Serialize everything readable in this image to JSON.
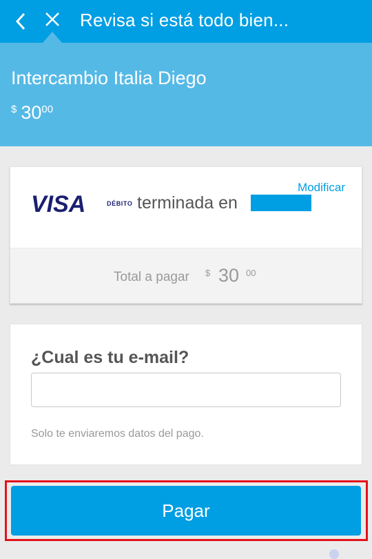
{
  "appbar": {
    "title": "Revisa si está todo bien...",
    "back_icon": "chevron-left-icon",
    "close_icon": "close-icon"
  },
  "header": {
    "title": "Intercambio Italia Diego",
    "amount_currency": "$",
    "amount_integer": "30",
    "amount_decimal": "00"
  },
  "payment_method": {
    "brand": "VISA",
    "brand_sub": "DÉBITO",
    "text": "terminada en",
    "modify_label": "Modificar"
  },
  "total": {
    "label": "Total a pagar",
    "currency": "$",
    "integer": "30",
    "decimal": "00"
  },
  "email": {
    "question": "¿Cual es tu e-mail?",
    "value": "",
    "placeholder": "",
    "note": "Solo te enviaremos datos del pago."
  },
  "pay_button": {
    "label": "Pagar"
  },
  "colors": {
    "primary": "#009ee3",
    "header": "#55b9e6",
    "highlight": "#e3131b",
    "visa": "#1a1f71"
  }
}
